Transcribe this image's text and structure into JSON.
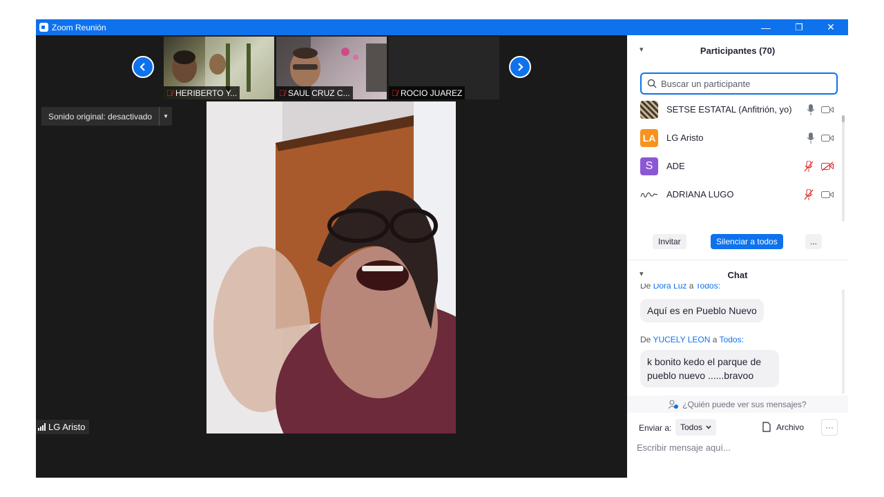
{
  "window": {
    "title": "Zoom Reunión",
    "controls": {
      "minimize": "—",
      "restore": "❐",
      "close": "✕"
    }
  },
  "gallery": {
    "prev_icon": "chevron-left-icon",
    "next_icon": "chevron-right-icon",
    "thumbnails": [
      {
        "name": "HERIBERTO Y...",
        "muted": true
      },
      {
        "name": "SAUL CRUZ C...",
        "muted": true
      },
      {
        "name": "ROCIO JUAREZ",
        "muted": true
      }
    ]
  },
  "audio": {
    "original_sound": "Sonido original: desactivado"
  },
  "speaker": {
    "name": "LG Aristo"
  },
  "participants": {
    "title": "Participantes (70)",
    "search_placeholder": "Buscar un participante",
    "list": [
      {
        "name": "SETSE ESTATAL (Anfitrión, yo)",
        "avatar": "image",
        "mic": "on",
        "video": "on"
      },
      {
        "name": "LG Aristo",
        "avatar_initials": "LA",
        "avatar_color": "#f7931e",
        "mic": "on",
        "video": "on"
      },
      {
        "name": "ADE",
        "avatar_initials": "S",
        "avatar_color": "#8b58d4",
        "mic": "off",
        "video": "off"
      },
      {
        "name": "ADRIANA LUGO",
        "avatar": "signature",
        "mic": "off",
        "video": "on"
      }
    ],
    "buttons": {
      "invite": "Invitar",
      "mute_all": "Silenciar a todos",
      "more": "..."
    }
  },
  "chat": {
    "title": "Chat",
    "messages": [
      {
        "from_prefix": "De",
        "sender": "Dora Luz",
        "to_prefix": "a",
        "recipient": "Todos:",
        "text": "Aquí es en Pueblo Nuevo"
      },
      {
        "from_prefix": "De",
        "sender": "YUCELY LEON",
        "to_prefix": "a",
        "recipient": "Todos:",
        "text": "k bonito kedo el parque de pueblo nuevo ......bravoo"
      }
    ],
    "who_can_see": "¿Quién puede ver sus mensajes?",
    "send_to_label": "Enviar a:",
    "send_to_value": "Todos",
    "file_label": "Archivo",
    "more_label": "···",
    "input_placeholder": "Escribir mensaje aquí..."
  },
  "colors": {
    "zoom_blue": "#0e72ed",
    "muted_red": "#e02828",
    "video_bg": "#1a1a1a"
  }
}
